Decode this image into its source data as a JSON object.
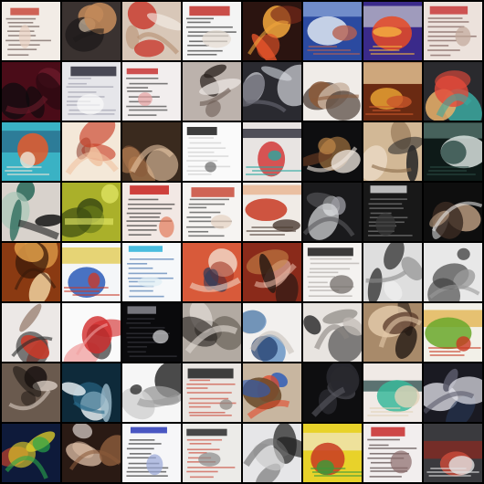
{
  "grid": {
    "rows": 8,
    "cols": 8,
    "tiles": [
      {
        "bg": "#f2ece6",
        "c1": "#c94a3c",
        "c2": "#5b4a45",
        "c3": "#e9d2c2",
        "style": "doc"
      },
      {
        "bg": "#3a3230",
        "c1": "#c28a5a",
        "c2": "#1e1a1a",
        "c3": "#e8d2b8",
        "style": "blob"
      },
      {
        "bg": "#d8c7b8",
        "c1": "#c83b2f",
        "c2": "#b58d6f",
        "c3": "#f5efe8",
        "style": "blob"
      },
      {
        "bg": "#f4f4f4",
        "c1": "#c2302a",
        "c2": "#1a1a1a",
        "c3": "#e6dcd2",
        "style": "doc"
      },
      {
        "bg": "#2b1410",
        "c1": "#e4542a",
        "c2": "#f0a53c",
        "c3": "#7a2a1a",
        "style": "blob"
      },
      {
        "bg": "#2b4aa0",
        "c1": "#dfe8f2",
        "c2": "#b86050",
        "c3": "#8aa4d8",
        "style": "poster"
      },
      {
        "bg": "#3a2a8a",
        "c1": "#e84a24",
        "c2": "#f6b340",
        "c3": "#c2c2cc",
        "style": "poster"
      },
      {
        "bg": "#ece2dc",
        "c1": "#c83a3a",
        "c2": "#6a4a44",
        "c3": "#c2a89a",
        "style": "doc"
      },
      {
        "bg": "#4a0c18",
        "c1": "#0e0a0e",
        "c2": "#6a1a2a",
        "c3": "#2a0810",
        "style": "blob"
      },
      {
        "bg": "#e6e6ea",
        "c1": "#2b2b3a",
        "c2": "#9a9aa8",
        "c3": "#fafafa",
        "style": "doc"
      },
      {
        "bg": "#f2eeee",
        "c1": "#c83232",
        "c2": "#2a2a2a",
        "c3": "#e6a0a0",
        "style": "doc"
      },
      {
        "bg": "#bcb2ac",
        "c1": "#2a221e",
        "c2": "#6a5a52",
        "c3": "#e8e2de",
        "style": "blob"
      },
      {
        "bg": "#2a2a30",
        "c1": "#d8dadf",
        "c2": "#6a6a74",
        "c3": "#a8acb2",
        "style": "blob"
      },
      {
        "bg": "#f0ece8",
        "c1": "#3a2a22",
        "c2": "#8a5a3a",
        "c3": "#c8b2a0",
        "style": "blob"
      },
      {
        "bg": "#6a2a12",
        "c1": "#e6a032",
        "c2": "#c8562a",
        "c3": "#f0d2a0",
        "style": "poster"
      },
      {
        "bg": "#2a2a2e",
        "c1": "#e24a3a",
        "c2": "#3aa8a0",
        "c3": "#e8b06a",
        "style": "blob"
      },
      {
        "bg": "#3ab2c4",
        "c1": "#e85a2a",
        "c2": "#f0e6d8",
        "c3": "#2a6a8a",
        "style": "poster"
      },
      {
        "bg": "#f4e8d8",
        "c1": "#c83a22",
        "c2": "#f0c2a0",
        "c3": "#8a3a2a",
        "style": "blob"
      },
      {
        "bg": "#3a2a1e",
        "c1": "#c48a5a",
        "c2": "#e2c2a0",
        "c3": "#8a5a3a",
        "style": "blob"
      },
      {
        "bg": "#fafafa",
        "c1": "#1a1a1a",
        "c2": "#c8c8c8",
        "c3": "#6a6a6a",
        "style": "doc"
      },
      {
        "bg": "#e8e4e2",
        "c1": "#d23a3a",
        "c2": "#2aa8a0",
        "c3": "#1e1e2a",
        "style": "poster"
      },
      {
        "bg": "#0e0e10",
        "c1": "#c48a4a",
        "c2": "#f0e8e0",
        "c3": "#6a3a22",
        "style": "blob"
      },
      {
        "bg": "#d2b896",
        "c1": "#2a2a2a",
        "c2": "#8a6a4a",
        "c3": "#f0e2d0",
        "style": "blob"
      },
      {
        "bg": "#0e1a18",
        "c1": "#d8e2de",
        "c2": "#2a4a44",
        "c3": "#5a7a72",
        "style": "poster"
      },
      {
        "bg": "#d8d2cc",
        "c1": "#2a6a5a",
        "c2": "#1a1a1a",
        "c3": "#a8c8b8",
        "style": "blob"
      },
      {
        "bg": "#aab02a",
        "c1": "#3a4a12",
        "c2": "#e8ec6a",
        "c3": "#6a7a1a",
        "style": "blob"
      },
      {
        "bg": "#f2e8e4",
        "c1": "#c8221e",
        "c2": "#1e1e1e",
        "c3": "#e27a5a",
        "style": "doc"
      },
      {
        "bg": "#f6f4f2",
        "c1": "#c84a3a",
        "c2": "#2a2a2a",
        "c3": "#e6d2c2",
        "style": "doc"
      },
      {
        "bg": "#f0ebe6",
        "c1": "#c83a22",
        "c2": "#4a3a32",
        "c3": "#e8b08a",
        "style": "poster"
      },
      {
        "bg": "#1a1a1c",
        "c1": "#d8dadc",
        "c2": "#5a5a5e",
        "c3": "#9a9aa0",
        "style": "blob"
      },
      {
        "bg": "#181818",
        "c1": "#d8d8d8",
        "c2": "#8a8a8a",
        "c3": "#3a3a3a",
        "style": "doc"
      },
      {
        "bg": "#0e0e0e",
        "c1": "#caa88a",
        "c2": "#e2e2e2",
        "c3": "#3a2a22",
        "style": "blob"
      },
      {
        "bg": "#8a3a12",
        "c1": "#e2a04a",
        "c2": "#3a1a0a",
        "c3": "#f0d2a0",
        "style": "blob"
      },
      {
        "bg": "#f4f6f8",
        "c1": "#2a5ab8",
        "c2": "#c83a2a",
        "c3": "#e2c84a",
        "style": "poster"
      },
      {
        "bg": "#f6f8fa",
        "c1": "#2ab2d8",
        "c2": "#3a6aa8",
        "c3": "#e0eef4",
        "style": "doc"
      },
      {
        "bg": "#d85a3a",
        "c1": "#2a3a5a",
        "c2": "#f0d2c2",
        "c3": "#9a2a1a",
        "style": "blob"
      },
      {
        "bg": "#8a2a1a",
        "c1": "#2a1a14",
        "c2": "#e2b2a0",
        "c3": "#c8884a",
        "style": "blob"
      },
      {
        "bg": "#f4f2f0",
        "c1": "#1a1a1a",
        "c2": "#a8a4a0",
        "c3": "#6a6460",
        "style": "doc"
      },
      {
        "bg": "#dedede",
        "c1": "#1a1a1a",
        "c2": "#8a8a8a",
        "c3": "#f4f4f4",
        "style": "blob"
      },
      {
        "bg": "#e8e8e8",
        "c1": "#3a3a3a",
        "c2": "#9a9a9a",
        "c3": "#1a1a1a",
        "style": "blob"
      },
      {
        "bg": "#ece8e6",
        "c1": "#c83a2a",
        "c2": "#2a2a2a",
        "c3": "#8a6a5a",
        "style": "blob"
      },
      {
        "bg": "#fafafa",
        "c1": "#d22a2a",
        "c2": "#f0a0a0",
        "c3": "#2a2a2a",
        "style": "blob"
      },
      {
        "bg": "#0a0a0c",
        "c1": "#8a8a92",
        "c2": "#3a3a42",
        "c3": "#d8d8dc",
        "style": "doc"
      },
      {
        "bg": "#b2aaa2",
        "c1": "#2a2622",
        "c2": "#e2dcd6",
        "c3": "#6a625a",
        "style": "blob"
      },
      {
        "bg": "#f2f0ee",
        "c1": "#2a6ab2",
        "c2": "#c8c2ba",
        "c3": "#1e3a6a",
        "style": "blob"
      },
      {
        "bg": "#e8e4e0",
        "c1": "#2a2a2a",
        "c2": "#8a8680",
        "c3": "#c2bcb6",
        "style": "blob"
      },
      {
        "bg": "#a88a6a",
        "c1": "#1a120e",
        "c2": "#e2c8a8",
        "c3": "#5a3a2a",
        "style": "blob"
      },
      {
        "bg": "#f2f0e8",
        "c1": "#6aa82a",
        "c2": "#c83a22",
        "c3": "#e2b24a",
        "style": "poster"
      },
      {
        "bg": "#6a5a4e",
        "c1": "#1a1412",
        "c2": "#d8ccc2",
        "c3": "#3a2e28",
        "style": "blob"
      },
      {
        "bg": "#0e2a3a",
        "c1": "#e2eaee",
        "c2": "#2a6a8a",
        "c3": "#9ab8c8",
        "style": "blob"
      },
      {
        "bg": "#f6f6f6",
        "c1": "#2a2a2a",
        "c2": "#9a9a9a",
        "c3": "#d2d2d2",
        "style": "blob"
      },
      {
        "bg": "#eae6e2",
        "c1": "#1e1e1e",
        "c2": "#c83a2a",
        "c3": "#8a8480",
        "style": "doc"
      },
      {
        "bg": "#c8b6a0",
        "c1": "#2a5ab8",
        "c2": "#e2482a",
        "c3": "#6a4a2a",
        "style": "blob"
      },
      {
        "bg": "#0e0e10",
        "c1": "#2a2a30",
        "c2": "#5a5a62",
        "c3": "#1a1a1e",
        "style": "blob"
      },
      {
        "bg": "#f0eae6",
        "c1": "#3ab89a",
        "c2": "#e2d2b8",
        "c3": "#2a4a4a",
        "style": "poster"
      },
      {
        "bg": "#1a1a22",
        "c1": "#e2e2ea",
        "c2": "#5a5a6a",
        "c3": "#2a3a5a",
        "style": "blob"
      },
      {
        "bg": "#0e1a3a",
        "c1": "#e2d22a",
        "c2": "#2aa84a",
        "c3": "#e24a2a",
        "style": "blob"
      },
      {
        "bg": "#2a1a14",
        "c1": "#e2c2a8",
        "c2": "#8a5a3a",
        "c3": "#f6eee8",
        "style": "blob"
      },
      {
        "bg": "#f6f6f8",
        "c1": "#2a3ab8",
        "c2": "#1a1a1a",
        "c3": "#9aa8d8",
        "style": "doc"
      },
      {
        "bg": "#ecebe8",
        "c1": "#2a2a2a",
        "c2": "#c83a2a",
        "c3": "#8a8a8a",
        "style": "doc"
      },
      {
        "bg": "#e6e6e8",
        "c1": "#1a1a1a",
        "c2": "#6a6a6a",
        "c3": "#cacaca",
        "style": "blob"
      },
      {
        "bg": "#e8d22a",
        "c1": "#c83a22",
        "c2": "#3a9a3a",
        "c3": "#f0e6c2",
        "style": "poster"
      },
      {
        "bg": "#f2eeee",
        "c1": "#c82a2a",
        "c2": "#3a2a2a",
        "c3": "#8a6a6a",
        "style": "doc"
      },
      {
        "bg": "#3a3a3e",
        "c1": "#c84a3a",
        "c2": "#e2e2e2",
        "c3": "#8a2a22",
        "style": "poster"
      }
    ]
  }
}
